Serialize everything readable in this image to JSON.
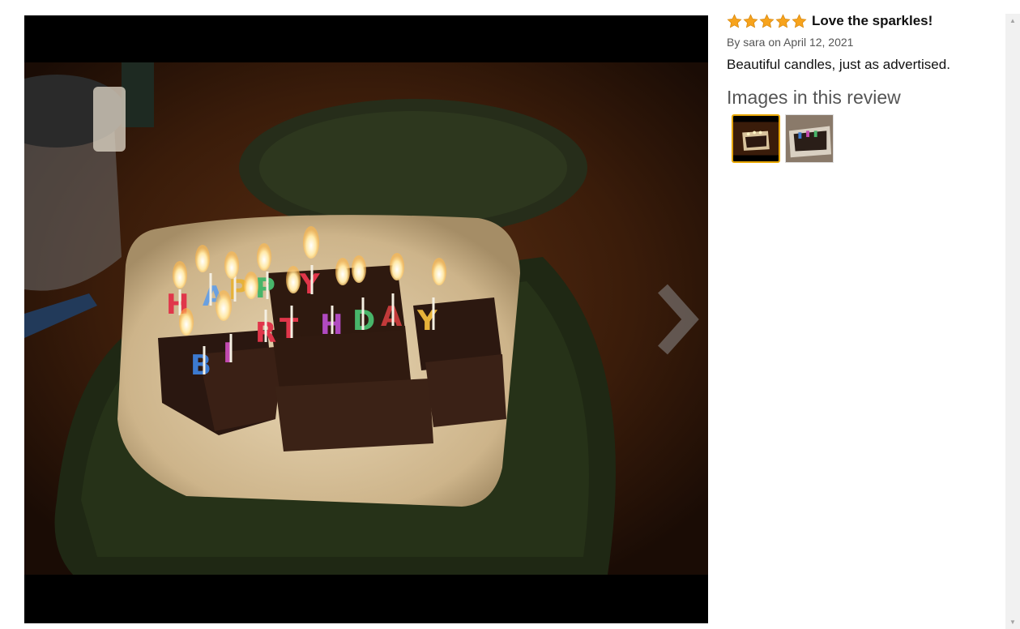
{
  "review": {
    "rating": 5,
    "title": "Love the sparkles!",
    "byline": "By sara on April 12, 2021",
    "body": "Beautiful candles, just as advertised.",
    "images_heading": "Images in this review"
  },
  "viewer": {
    "next_icon": "chevron-right-icon"
  },
  "thumbnails": [
    {
      "icon": "cake-photo-thumbnail",
      "selected": true
    },
    {
      "icon": "cake-photo-thumbnail-2",
      "selected": false
    }
  ],
  "colors": {
    "star": "#f7a31c",
    "selected_border": "#e7a600"
  }
}
